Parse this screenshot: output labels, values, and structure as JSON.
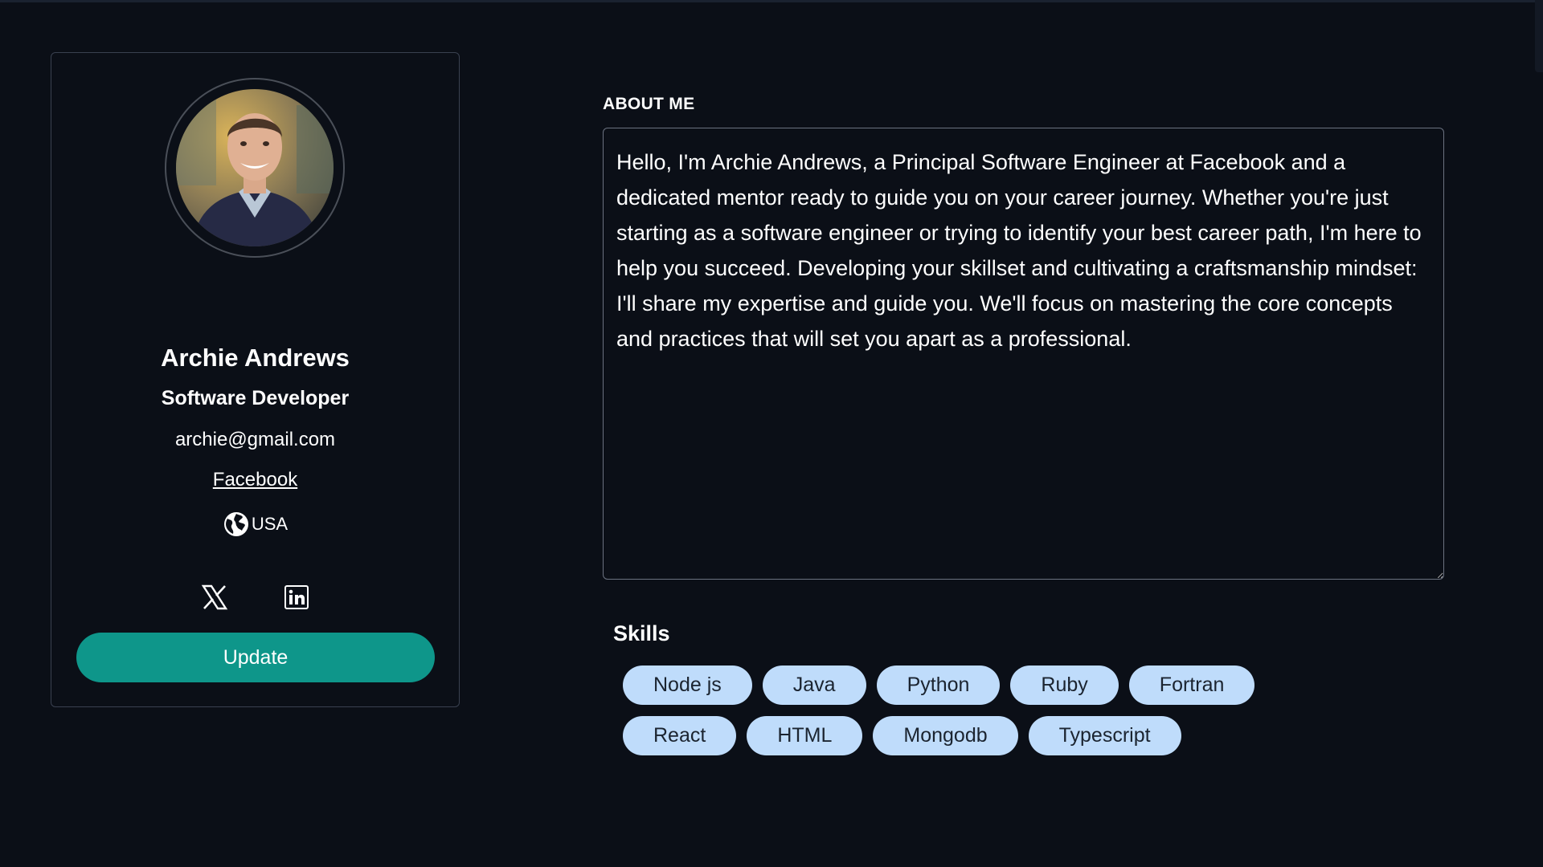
{
  "profile": {
    "name": "Archie Andrews",
    "role": "Software Developer",
    "email": "archie@gmail.com",
    "company_link": "Facebook",
    "country": "USA",
    "socials": [
      {
        "icon": "x-twitter-icon"
      },
      {
        "icon": "linkedin-icon"
      }
    ],
    "update_label": "Update"
  },
  "about": {
    "label": "ABOUT ME",
    "text": "Hello, I'm Archie Andrews, a Principal Software Engineer at Facebook and a dedicated mentor ready to guide you on your career journey. Whether you're just starting as a software engineer or trying to identify your best career path, I'm here to help you succeed. Developing your skillset and cultivating a craftsmanship mindset: I'll share my expertise and guide you. We'll focus on mastering the core concepts and practices that will set you apart as a professional."
  },
  "skills": {
    "label": "Skills",
    "items": [
      "Node js",
      "Java",
      "Python",
      "Ruby",
      "Fortran",
      "React",
      "HTML",
      "Mongodb",
      "Typescript"
    ]
  },
  "colors": {
    "background": "#0b0f17",
    "accent_button": "#0e968a",
    "skill_chip": "#bfdcfb"
  }
}
